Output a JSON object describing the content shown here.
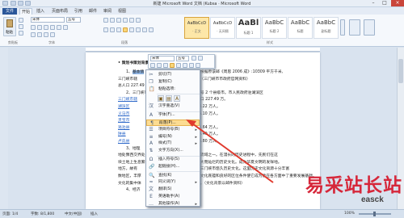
{
  "window": {
    "title": "新建 Microsoft Word 文档 (Kubsa · Microsoft Word"
  },
  "tabs": [
    "文件",
    "开始",
    "插入",
    "页面布局",
    "引用",
    "邮件",
    "审阅",
    "视图"
  ],
  "ribbon": {
    "paste_label": "粘贴",
    "font_name": "宋体",
    "font_size": "五号",
    "groups": [
      "剪贴板",
      "字体",
      "段落",
      "样式"
    ],
    "styles": [
      {
        "preview": "AaBbCcD",
        "name": "· 正文"
      },
      {
        "preview": "AaBbCcD",
        "name": "· 无间隔"
      },
      {
        "preview": "AaBl",
        "name": "标题 1"
      },
      {
        "preview": "AaBbC",
        "name": "标题 2"
      },
      {
        "preview": "AaBbC",
        "name": "标题"
      },
      {
        "preview": "AaBbC",
        "name": "副标题"
      }
    ]
  },
  "document": {
    "heading": "• 策划书策划背景 ——",
    "lines": [
      {
        "num": "1、",
        "text": "基本情",
        "tail": "（根据原该邮《周思 2006 成》:10309 平方千米,"
      },
      {
        "num": "",
        "text": "三门峡市辖",
        "tail": "①（三门峡市市政府官网资料）"
      },
      {
        "num": "",
        "text": "总人口 227.49 万人",
        "tail": ""
      },
      {
        "num": "2、",
        "text": "三门峡市",
        "tail": "代号 2 个县级市。市人民政府驻湖滨区"
      },
      {
        "num": "",
        "text": "三门峡市辖",
        "tail": "人口 227.49 万。"
      },
      {
        "num": "",
        "text": "湖滨区",
        "tail": "33.22 万人。"
      },
      {
        "num": "",
        "text": "义马市",
        "tail": "16.10 万人。"
      },
      {
        "num": "",
        "text": "灵宝市",
        "tail": ""
      },
      {
        "num": "",
        "text": "渑池县",
        "tail": "33.64 万人。"
      },
      {
        "num": "",
        "text": "陕县",
        "tail": "34.49 万人。"
      },
      {
        "num": "",
        "text": "卢氏县",
        "tail": "35.80 万人。"
      },
      {
        "num": "3、",
        "text": "地理",
        "tail": ""
      },
      {
        "num": "",
        "text": "地处豫西交界处",
        "tail": "河流域之一。在漫长的历史进程中，先民们在这"
      },
      {
        "num": "",
        "text": "块土地上生息繁衍",
        "tail": "伟大而灿烂的历史文化。成为华夏文明的发祥地。"
      },
      {
        "num": "",
        "text": "地方，故有",
        "tail": "了三门峡市悠久历史文化。这里历史文化资源十分丰富"
      },
      {
        "num": "",
        "text": "数地区，丰厚",
        "tail": "的文化底蕴和良好的区位条件使它成为能在各方面中了重要发展基础。"
      },
      {
        "num": "",
        "text": "文化的集中体",
        "tail": "现。（文化背景以邮件资料）"
      },
      {
        "num": "4、",
        "text": "经济",
        "tail": ""
      }
    ]
  },
  "context_menu": {
    "items": [
      {
        "label": "剪切(T)",
        "icon": "scissors-icon"
      },
      {
        "label": "复制(C)",
        "icon": "copy-icon"
      },
      {
        "label": "粘贴选项:",
        "icon": "paste-icon"
      },
      {
        "label": "",
        "icon": "paste-options"
      },
      {
        "label": "汉字重选(V)",
        "icon": "hanzi-icon"
      },
      {
        "label": "字体(F)...",
        "icon": "font-icon"
      },
      {
        "label": "段落(P)...",
        "icon": "paragraph-icon"
      },
      {
        "label": "项目符号(B)",
        "icon": "bullets-icon",
        "submenu": true
      },
      {
        "label": "编号(N)",
        "icon": "numbering-icon",
        "submenu": true
      },
      {
        "label": "样式(T)",
        "icon": "styles-icon",
        "submenu": true
      },
      {
        "label": "文字方向(X)...",
        "icon": "text-direction-icon"
      },
      {
        "label": "插入符号(S)",
        "icon": "symbol-icon"
      },
      {
        "label": "超链接(H)...",
        "icon": "hyperlink-icon"
      },
      {
        "label": "查找(K)",
        "icon": "lookup-icon"
      },
      {
        "label": "同义词(Y)",
        "icon": "synonym-icon",
        "submenu": true
      },
      {
        "label": "翻译(S)",
        "icon": "translate-icon"
      },
      {
        "label": "英语助手(A)",
        "icon": "english-assistant-icon"
      },
      {
        "label": "其他操作(A)",
        "icon": "more-actions-icon",
        "submenu": true
      }
    ],
    "highlighted_index": 6
  },
  "mini_toolbar": {
    "font": "宋体",
    "size": "五号"
  },
  "status": {
    "page": "页面: 1/4",
    "words": "字数: 8/1,800",
    "lang": "中文(中国)",
    "mode": "插入",
    "zoom": "100%"
  },
  "watermark": {
    "text": "易采站长站",
    "url": "easck"
  },
  "colors": {
    "accent": "#2b579a",
    "highlight": "#fcdc92",
    "arrow": "#e03a2e"
  }
}
